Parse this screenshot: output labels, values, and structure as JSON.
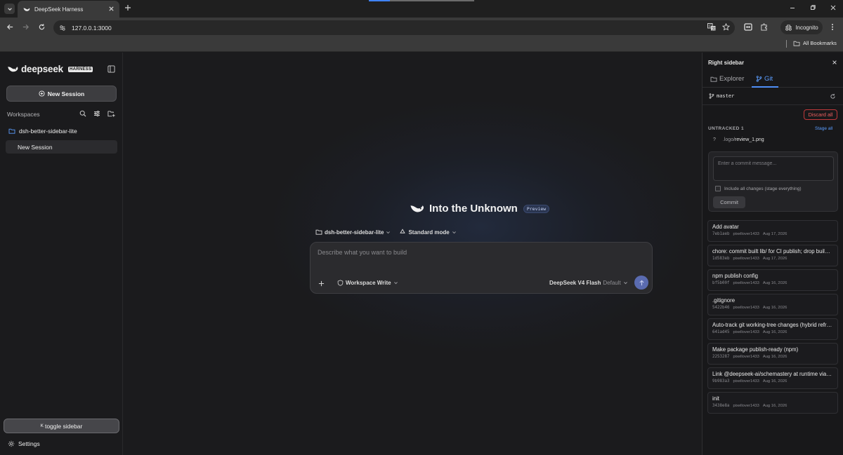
{
  "browser": {
    "tab_title": "DeepSeek Harness",
    "url": "127.0.0.1:3000",
    "incognito_label": "Incognito",
    "bookmarks_label": "All Bookmarks"
  },
  "left_sidebar": {
    "brand_name": "deepseek",
    "brand_badge": "HARNESS",
    "new_session_label": "New Session",
    "workspaces_label": "Workspaces",
    "workspace_name": "dsh-better-sidebar-lite",
    "session_name": "New Session",
    "toggle_shortcut": "K",
    "toggle_label": "toggle sidebar",
    "settings_label": "Settings"
  },
  "main": {
    "hero_title": "Into the Unknown",
    "preview_badge": "Preview",
    "workspace_select": "dsh-better-sidebar-lite",
    "mode_select": "Standard mode",
    "composer_placeholder": "Describe what you want to build",
    "permission_select": "Workspace Write",
    "model_name": "DeepSeek V4 Flash",
    "model_tag": "Default"
  },
  "right_sidebar": {
    "title": "Right sidebar",
    "tabs": [
      {
        "label": "Explorer",
        "active": false
      },
      {
        "label": "Git",
        "active": true
      }
    ],
    "branch": "master",
    "discard_all_label": "Discard all",
    "untracked_label": "UNTRACKED",
    "untracked_count": "1",
    "stage_all_label": "Stage all",
    "untracked_files": [
      {
        "status": "?",
        "dir": ".logo/",
        "name": "review_1.png"
      }
    ],
    "commit_placeholder": "Enter a commit message...",
    "include_all_label": "Include all changes (stage everything)",
    "commit_label": "Commit",
    "commits": [
      {
        "message": "Add avatar",
        "hash": "7eb1aeb",
        "author": "pixellover1433",
        "date": "Aug 17, 2026"
      },
      {
        "message": "chore: commit built lib/ for CI publish; drop build script",
        "hash": "1d583eb",
        "author": "pixellover1433",
        "date": "Aug 17, 2026"
      },
      {
        "message": "npm publish config",
        "hash": "bf5b00f",
        "author": "pixellover1433",
        "date": "Aug 16, 2026"
      },
      {
        "message": ".gitignore",
        "hash": "5422b46",
        "author": "pixellover1433",
        "date": "Aug 16, 2026"
      },
      {
        "message": "Auto-track git working-tree changes (hybrid refresh)",
        "hash": "641ad45",
        "author": "pixellover1433",
        "date": "Aug 16, 2026"
      },
      {
        "message": "Make package publish-ready (npm)",
        "hash": "2253287",
        "author": "pixellover1433",
        "date": "Aug 16, 2026"
      },
      {
        "message": "Link @deepseek-ai/schemastery at runtime via peer dependency",
        "hash": "9b983a3",
        "author": "pixellover1433",
        "date": "Aug 16, 2026"
      },
      {
        "message": "init",
        "hash": "3438e8a",
        "author": "pixellover1433",
        "date": "Aug 16, 2026"
      }
    ]
  },
  "colors": {
    "accent": "#4f8ff7",
    "danger": "#e55353",
    "send_button": "#5a6bb0"
  }
}
